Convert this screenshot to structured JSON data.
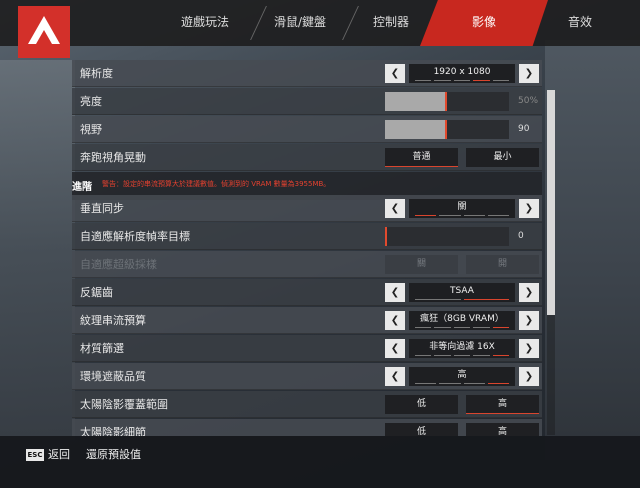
{
  "tabs": [
    {
      "label": "遊戲玩法"
    },
    {
      "label": "滑鼠/鍵盤"
    },
    {
      "label": "控制器"
    },
    {
      "label": "影像"
    },
    {
      "label": "音效"
    }
  ],
  "active_tab": "影像",
  "settings": {
    "resolution": {
      "label": "解析度",
      "value": "1920 x 1080"
    },
    "brightness": {
      "label": "亮度",
      "value": "50%",
      "level": 0.5
    },
    "fov": {
      "label": "視野",
      "value": "90",
      "level": 0.5
    },
    "sprint_shake": {
      "label": "奔跑視角晃動",
      "options": [
        "普通",
        "最小"
      ],
      "selected": "普通"
    },
    "advanced": {
      "label": "進階",
      "warning": "警告：設定的串流預算大於建議數值。偵測到的 VRAM 數量為3955MB。"
    },
    "vsync": {
      "label": "垂直同步",
      "value": "關"
    },
    "adaptive_res": {
      "label": "自適應解析度幀率目標",
      "value": "0",
      "level": 0.0
    },
    "adaptive_ss": {
      "label": "自適應超級採樣",
      "options": [
        "關",
        "開"
      ]
    },
    "antialias": {
      "label": "反鋸齒",
      "value": "TSAA"
    },
    "texture_budget": {
      "label": "紋理串流預算",
      "value": "瘋狂（8GB VRAM）"
    },
    "texture_filter": {
      "label": "材質篩選",
      "value": "非等向過濾 16X"
    },
    "ambient_occlusion": {
      "label": "環境遮蔽品質",
      "value": "高"
    },
    "sun_shadow_coverage": {
      "label": "太陽陰影覆蓋範圍",
      "options": [
        "低",
        "高"
      ],
      "selected": "高"
    },
    "sun_shadow_detail": {
      "label": "太陽陰影細節",
      "options": [
        "低",
        "高"
      ],
      "selected": "高"
    }
  },
  "footer": {
    "esc_key": "ESC",
    "back_label": "返回",
    "restore_label": "還原預設值"
  },
  "colors": {
    "accent": "#c8281f",
    "pip_on": "#d9452e"
  }
}
